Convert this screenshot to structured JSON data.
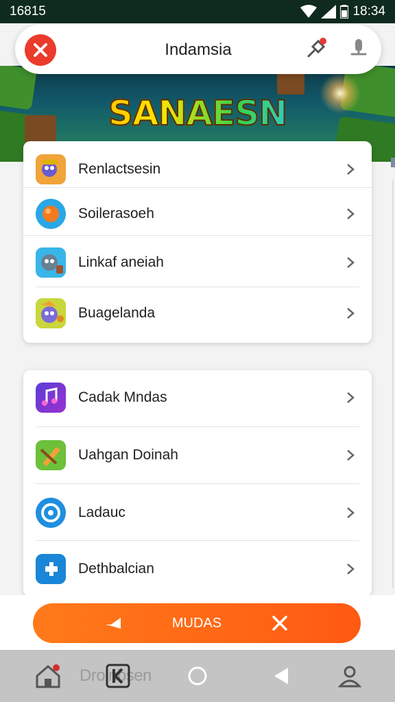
{
  "status_bar": {
    "left_time": "16815",
    "right_time": "18:34"
  },
  "top_bar": {
    "title": "Indamsia"
  },
  "banner": {
    "logo_text": "SANAESN"
  },
  "group1": [
    {
      "label": "Renlactsesin",
      "icon": "game-character-icon"
    },
    {
      "label": "Soilerasoeh",
      "icon": "orange-ball-icon"
    },
    {
      "label": "Linkaf aneiah",
      "icon": "game-robot-icon"
    },
    {
      "label": "Buagelanda",
      "icon": "game-bird-icon"
    }
  ],
  "group2": [
    {
      "label": "Cadak Mndas",
      "icon": "music-note-icon"
    },
    {
      "label": "Uahgan Doinah",
      "icon": "pencil-ruler-icon"
    },
    {
      "label": "Ladauc",
      "icon": "target-circle-icon"
    },
    {
      "label": "Dethbalcian",
      "icon": "puzzle-plus-icon"
    }
  ],
  "action": {
    "label": "MUDAS"
  },
  "nav": {
    "ghost_text": "Drolnbsen"
  },
  "colors": {
    "accent": "#ff6a16",
    "close_red": "#ea3b2c",
    "status_bg": "#0f2a1e"
  }
}
